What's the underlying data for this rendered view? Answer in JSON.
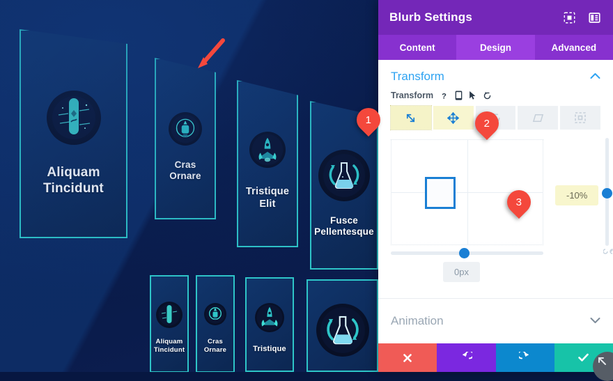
{
  "panel": {
    "title": "Blurb Settings",
    "header_icons": [
      {
        "name": "focus-mode-icon",
        "glyph": "focus"
      },
      {
        "name": "panel-layout-icon",
        "glyph": "layout"
      }
    ],
    "tabs": [
      {
        "label": "Content",
        "active": false
      },
      {
        "label": "Design",
        "active": true
      },
      {
        "label": "Advanced",
        "active": false
      }
    ],
    "sections": {
      "transform": {
        "title": "Transform",
        "expanded": true,
        "chevron": "up",
        "field_label": "Transform",
        "field_icons": [
          {
            "name": "help-icon",
            "glyph": "?"
          },
          {
            "name": "responsive-mobile-icon",
            "glyph": "mobile"
          },
          {
            "name": "hover-cursor-icon",
            "glyph": "cursor"
          },
          {
            "name": "reset-icon",
            "glyph": "reset"
          }
        ],
        "mode_buttons": [
          {
            "name": "transform-scale-button",
            "icon": "scale-icon",
            "state": "highlighted"
          },
          {
            "name": "transform-translate-button",
            "icon": "move-icon",
            "state": "active"
          },
          {
            "name": "transform-rotate-button",
            "icon": "rotate-icon",
            "state": "default"
          },
          {
            "name": "transform-skew-button",
            "icon": "skew-icon",
            "state": "default"
          },
          {
            "name": "transform-origin-button",
            "icon": "origin-icon",
            "state": "default"
          }
        ],
        "vertical_slider_value": "-10%",
        "horizontal_slider_value": "0px"
      },
      "animation": {
        "title": "Animation",
        "expanded": false,
        "chevron": "down"
      }
    },
    "actions": [
      {
        "name": "discard-button",
        "icon": "close-icon",
        "color": "#f05b56"
      },
      {
        "name": "undo-button",
        "icon": "undo-icon",
        "color": "#7b28e0"
      },
      {
        "name": "redo-button",
        "icon": "redo-icon",
        "color": "#0c88ce"
      },
      {
        "name": "save-button",
        "icon": "check-icon",
        "color": "#17c3a8"
      }
    ],
    "resize_handle": {
      "name": "panel-resize-handle",
      "icon": "resize-arrow-icon"
    }
  },
  "annotations": [
    {
      "label": "1",
      "name": "annotation-badge-1"
    },
    {
      "label": "2",
      "name": "annotation-badge-2"
    },
    {
      "label": "3",
      "name": "annotation-badge-3"
    },
    {
      "label": "",
      "name": "annotation-arrow",
      "type": "arrow"
    }
  ],
  "canvas": {
    "cards_top": [
      {
        "title": "Aliquam\nTincidunt",
        "icon": "snowboard-space-icon"
      },
      {
        "title": "Cras\nOrnare",
        "icon": "astronaut-icon"
      },
      {
        "title": "Tristique\nElit",
        "icon": "rocket-launch-icon"
      },
      {
        "title": "Fusce\nPellentesque",
        "icon": "flask-icon"
      }
    ],
    "cards_bottom": [
      {
        "title": "Aliquam\nTincidunt",
        "icon": "snowboard-space-icon"
      },
      {
        "title": "Cras\nOrnare",
        "icon": "astronaut-icon"
      },
      {
        "title": "Tristique",
        "icon": "rocket-launch-icon"
      },
      {
        "title": "",
        "icon": "flask-icon"
      }
    ]
  },
  "colors": {
    "panel_header": "#7427b8",
    "panel_tabs": "#8731cf",
    "panel_tab_active": "#9a3fe0",
    "accent_blue": "#2ea3f2",
    "slider_blue": "#1a7fd4",
    "highlight_yellow": "#f5f3c8",
    "annotation_red": "#f4483c",
    "card_border": "#2ec5c8",
    "canvas_bg": "#0a1f52"
  }
}
